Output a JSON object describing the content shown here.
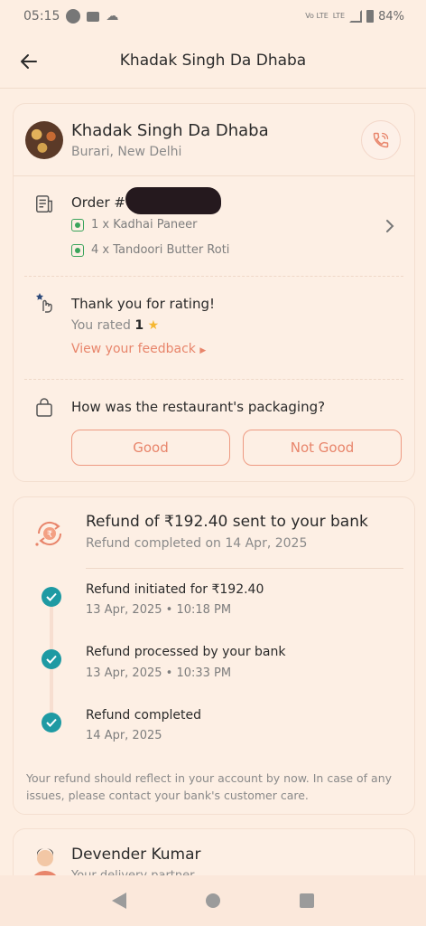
{
  "status": {
    "time": "05:15",
    "network": "Vo LTE",
    "network2": "LTE",
    "battery": "84%"
  },
  "header": {
    "title": "Khadak Singh Da Dhaba"
  },
  "restaurant": {
    "name": "Khadak Singh Da Dhaba",
    "location": "Burari, New Delhi"
  },
  "order": {
    "label": "Order #",
    "items": [
      "1 x Kadhai Paneer",
      "4 x Tandoori Butter Roti"
    ]
  },
  "rating": {
    "title": "Thank you for rating!",
    "rated_prefix": "You rated",
    "rated_value": "1",
    "feedback_link": "View your feedback"
  },
  "packaging": {
    "question": "How was the restaurant's packaging?",
    "good": "Good",
    "not_good": "Not Good"
  },
  "refund": {
    "title": "Refund of ₹192.40 sent to your bank",
    "subtitle": "Refund completed on 14 Apr, 2025",
    "steps": [
      {
        "title": "Refund initiated for ₹192.40",
        "time": "13 Apr, 2025 • 10:18 PM"
      },
      {
        "title": "Refund processed by your bank",
        "time": "13 Apr, 2025 • 10:33 PM"
      },
      {
        "title": "Refund completed",
        "time": "14 Apr, 2025"
      }
    ],
    "note": "Your refund should reflect in your account by now. In case of any issues, please contact your bank's customer care."
  },
  "delivery": {
    "name": "Devender Kumar",
    "role": "Your delivery partner"
  },
  "colors": {
    "accent": "#e8856b",
    "check": "#1e9aa3",
    "background": "#fdeee2"
  }
}
